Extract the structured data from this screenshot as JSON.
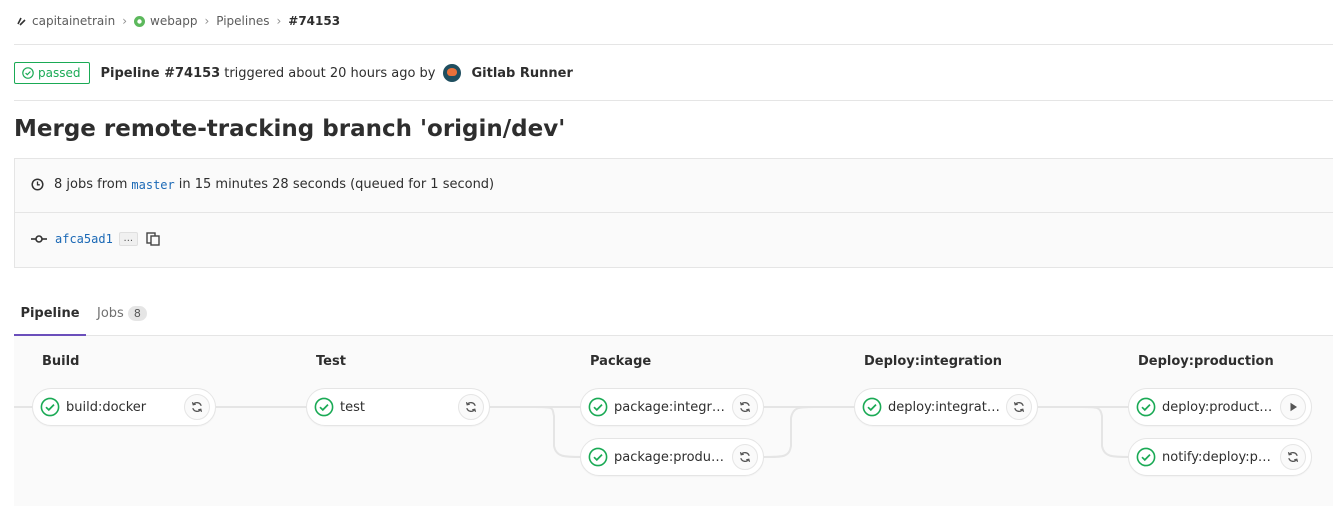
{
  "breadcrumb": {
    "group": "capitainetrain",
    "project": "webapp",
    "section": "Pipelines",
    "current": "#74153"
  },
  "status": {
    "badge": "passed",
    "pipeline": "Pipeline #74153",
    "triggered": "triggered about 20 hours ago by",
    "user": "Gitlab Runner"
  },
  "commit": {
    "title": "Merge remote-tracking branch 'origin/dev'",
    "jobs_prefix": "8 jobs from",
    "branch": "master",
    "duration": "in 15 minutes 28 seconds (queued for 1 second)",
    "sha": "afca5ad1",
    "ellipsis": "..."
  },
  "tabs": {
    "pipeline": "Pipeline",
    "jobs": "Jobs",
    "jobs_count": "8"
  },
  "stages": [
    {
      "title": "Build",
      "jobs": [
        {
          "name": "build:docker",
          "action": "retry"
        }
      ]
    },
    {
      "title": "Test",
      "jobs": [
        {
          "name": "test",
          "action": "retry"
        }
      ]
    },
    {
      "title": "Package",
      "jobs": [
        {
          "name": "package:integration",
          "action": "retry"
        },
        {
          "name": "package:production",
          "action": "retry"
        }
      ]
    },
    {
      "title": "Deploy:integration",
      "jobs": [
        {
          "name": "deploy:integration",
          "action": "retry"
        }
      ]
    },
    {
      "title": "Deploy:production",
      "jobs": [
        {
          "name": "deploy:production",
          "action": "play"
        },
        {
          "name": "notify:deploy:production",
          "action": "retry"
        }
      ]
    }
  ],
  "colors": {
    "success": "#1aaa55",
    "link": "#1b69b6",
    "tab_active": "#6b4fbb"
  }
}
